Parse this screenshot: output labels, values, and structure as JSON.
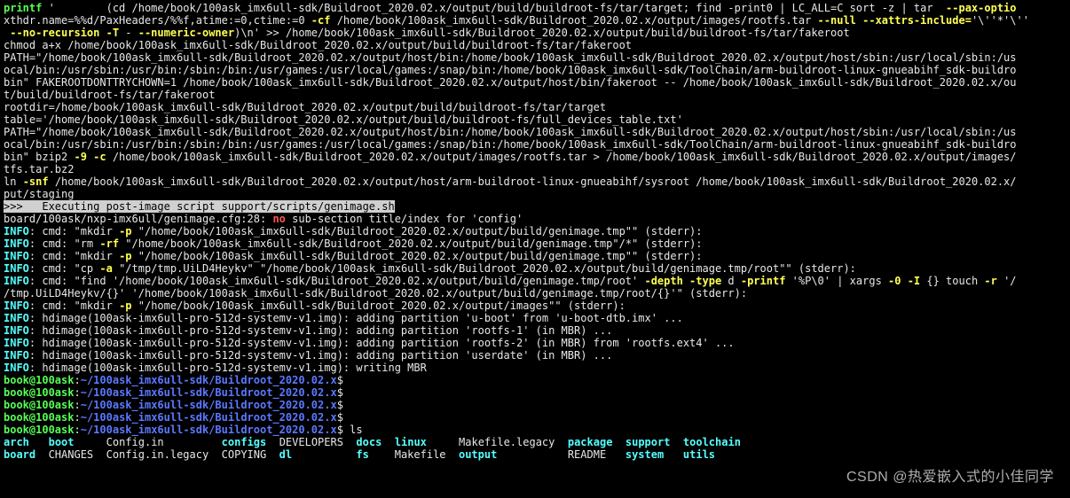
{
  "lines": [
    [
      {
        "c": "green",
        "t": "printf"
      },
      {
        "c": "white",
        "t": " '        (cd /home/book/100ask_imx6ull-sdk/Buildroot_2020.02.x/output/build/buildroot-fs/tar/target; find -print0 | LC_ALL=C sort -z | tar  "
      },
      {
        "c": "yellow",
        "t": "--pax-optio"
      }
    ],
    [
      {
        "c": "white",
        "t": "xthdr.name=%%d/PaxHeaders/%%f,atime:=0,ctime:=0 "
      },
      {
        "c": "yellow",
        "t": "-cf"
      },
      {
        "c": "white",
        "t": " /home/book/100ask_imx6ull-sdk/Buildroot_2020.02.x/output/images/rootfs.tar "
      },
      {
        "c": "yellow",
        "t": "--null --xattrs-include="
      },
      {
        "c": "white",
        "t": "'\\''*'\\''"
      }
    ],
    [
      {
        "c": "yellow",
        "t": " --no-recursion -T"
      },
      {
        "c": "white",
        "t": " - "
      },
      {
        "c": "yellow",
        "t": "--numeric-owner"
      },
      {
        "c": "white",
        "t": ")\\n' >> /home/book/100ask_imx6ull-sdk/Buildroot_2020.02.x/output/build/buildroot-fs/tar/fakeroot"
      }
    ],
    [
      {
        "c": "white",
        "t": "chmod a+x /home/book/100ask_imx6ull-sdk/Buildroot_2020.02.x/output/build/buildroot-fs/tar/fakeroot"
      }
    ],
    [
      {
        "c": "white",
        "t": "PATH=\"/home/book/100ask_imx6ull-sdk/Buildroot_2020.02.x/output/host/bin:/home/book/100ask_imx6ull-sdk/Buildroot_2020.02.x/output/host/sbin:/usr/local/sbin:/us"
      }
    ],
    [
      {
        "c": "white",
        "t": "ocal/bin:/usr/sbin:/usr/bin:/sbin:/bin:/usr/games:/usr/local/games:/snap/bin:/home/book/100ask_imx6ull-sdk/ToolChain/arm-buildroot-linux-gnueabihf_sdk-buildro"
      }
    ],
    [
      {
        "c": "white",
        "t": "bin\" FAKEROOTDONTTRYCHOWN=1 /home/book/100ask_imx6ull-sdk/Buildroot_2020.02.x/output/host/bin/fakeroot -- /home/book/100ask_imx6ull-sdk/Buildroot_2020.02.x/ou"
      }
    ],
    [
      {
        "c": "white",
        "t": "t/build/buildroot-fs/tar/fakeroot"
      }
    ],
    [
      {
        "c": "white",
        "t": "rootdir=/home/book/100ask_imx6ull-sdk/Buildroot_2020.02.x/output/build/buildroot-fs/tar/target"
      }
    ],
    [
      {
        "c": "white",
        "t": "table='/home/book/100ask_imx6ull-sdk/Buildroot_2020.02.x/output/build/buildroot-fs/full_devices_table.txt'"
      }
    ],
    [
      {
        "c": "white",
        "t": "PATH=\"/home/book/100ask_imx6ull-sdk/Buildroot_2020.02.x/output/host/bin:/home/book/100ask_imx6ull-sdk/Buildroot_2020.02.x/output/host/sbin:/usr/local/sbin:/us"
      }
    ],
    [
      {
        "c": "white",
        "t": "ocal/bin:/usr/sbin:/usr/bin:/sbin:/bin:/usr/games:/usr/local/games:/snap/bin:/home/book/100ask_imx6ull-sdk/ToolChain/arm-buildroot-linux-gnueabihf_sdk-buildro"
      }
    ],
    [
      {
        "c": "white",
        "t": "bin\" bzip2 "
      },
      {
        "c": "yellow",
        "t": "-9 -c"
      },
      {
        "c": "white",
        "t": " /home/book/100ask_imx6ull-sdk/Buildroot_2020.02.x/output/images/rootfs.tar > /home/book/100ask_imx6ull-sdk/Buildroot_2020.02.x/output/images/"
      }
    ],
    [
      {
        "c": "white",
        "t": "tfs.tar.bz2"
      }
    ],
    [
      {
        "c": "white",
        "t": "ln "
      },
      {
        "c": "yellow",
        "t": "-snf"
      },
      {
        "c": "white",
        "t": " /home/book/100ask_imx6ull-sdk/Buildroot_2020.02.x/output/host/arm-buildroot-linux-gnueabihf/sysroot /home/book/100ask_imx6ull-sdk/Buildroot_2020.02.x/"
      }
    ],
    [
      {
        "c": "white",
        "t": "put/staging"
      }
    ],
    [
      {
        "c": "inv",
        "t": ">>>   Executing post-image script support/scripts/genimage.sh"
      },
      {
        "c": "white",
        "t": "                                                                                                "
      }
    ],
    [
      {
        "c": "white",
        "t": "board/100ask/nxp-imx6ull/genimage.cfg:28: "
      },
      {
        "c": "red",
        "t": "no"
      },
      {
        "c": "white",
        "t": " sub-section title/index for 'config'"
      }
    ],
    [
      {
        "c": "cyan",
        "t": "INFO"
      },
      {
        "c": "white",
        "t": ": cmd: \"mkdir "
      },
      {
        "c": "yellow",
        "t": "-p"
      },
      {
        "c": "white",
        "t": " \"/home/book/100ask_imx6ull-sdk/Buildroot_2020.02.x/output/build/genimage.tmp\"\" (stderr):"
      }
    ],
    [
      {
        "c": "cyan",
        "t": "INFO"
      },
      {
        "c": "white",
        "t": ": cmd: \"rm "
      },
      {
        "c": "yellow",
        "t": "-rf"
      },
      {
        "c": "white",
        "t": " \"/home/book/100ask_imx6ull-sdk/Buildroot_2020.02.x/output/build/genimage.tmp\"/*\" (stderr):"
      }
    ],
    [
      {
        "c": "cyan",
        "t": "INFO"
      },
      {
        "c": "white",
        "t": ": cmd: \"mkdir "
      },
      {
        "c": "yellow",
        "t": "-p"
      },
      {
        "c": "white",
        "t": " \"/home/book/100ask_imx6ull-sdk/Buildroot_2020.02.x/output/build/genimage.tmp\"\" (stderr):"
      }
    ],
    [
      {
        "c": "cyan",
        "t": "INFO"
      },
      {
        "c": "white",
        "t": ": cmd: \"cp "
      },
      {
        "c": "yellow",
        "t": "-a"
      },
      {
        "c": "white",
        "t": " \"/tmp/tmp.UiLD4Heykv\" \"/home/book/100ask_imx6ull-sdk/Buildroot_2020.02.x/output/build/genimage.tmp/root\"\" (stderr):"
      }
    ],
    [
      {
        "c": "cyan",
        "t": "INFO"
      },
      {
        "c": "white",
        "t": ": cmd: \"find '/home/book/100ask_imx6ull-sdk/Buildroot_2020.02.x/output/build/genimage.tmp/root' "
      },
      {
        "c": "yellow",
        "t": "-depth -type"
      },
      {
        "c": "white",
        "t": " d "
      },
      {
        "c": "yellow",
        "t": "-printf"
      },
      {
        "c": "white",
        "t": " '%P\\0' | xargs "
      },
      {
        "c": "yellow",
        "t": "-0 -I"
      },
      {
        "c": "white",
        "t": " {} touch "
      },
      {
        "c": "yellow",
        "t": "-r"
      },
      {
        "c": "white",
        "t": " '/"
      }
    ],
    [
      {
        "c": "white",
        "t": "/tmp.UiLD4Heykv/{}' '/home/book/100ask_imx6ull-sdk/Buildroot_2020.02.x/output/build/genimage.tmp/root/{}'\" (stderr):"
      }
    ],
    [
      {
        "c": "cyan",
        "t": "INFO"
      },
      {
        "c": "white",
        "t": ": cmd: \"mkdir "
      },
      {
        "c": "yellow",
        "t": "-p"
      },
      {
        "c": "white",
        "t": " \"/home/book/100ask_imx6ull-sdk/Buildroot_2020.02.x/output/images\"\" (stderr):"
      }
    ],
    [
      {
        "c": "cyan",
        "t": "INFO"
      },
      {
        "c": "white",
        "t": ": hdimage(100ask-imx6ull-pro-512d-systemv-v1.img): adding partition 'u-boot' from 'u-boot-dtb.imx' ..."
      }
    ],
    [
      {
        "c": "cyan",
        "t": "INFO"
      },
      {
        "c": "white",
        "t": ": hdimage(100ask-imx6ull-pro-512d-systemv-v1.img): adding partition 'rootfs-1' (in MBR) ..."
      }
    ],
    [
      {
        "c": "cyan",
        "t": "INFO"
      },
      {
        "c": "white",
        "t": ": hdimage(100ask-imx6ull-pro-512d-systemv-v1.img): adding partition 'rootfs-2' (in MBR) from 'rootfs.ext4' ..."
      }
    ],
    [
      {
        "c": "cyan",
        "t": "INFO"
      },
      {
        "c": "white",
        "t": ": hdimage(100ask-imx6ull-pro-512d-systemv-v1.img): adding partition 'userdate' (in MBR) ..."
      }
    ],
    [
      {
        "c": "cyan",
        "t": "INFO"
      },
      {
        "c": "white",
        "t": ": hdimage(100ask-imx6ull-pro-512d-systemv-v1.img): writing MBR"
      }
    ],
    [
      {
        "c": "green",
        "t": "book@100ask"
      },
      {
        "c": "white",
        "t": ":"
      },
      {
        "c": "blue",
        "t": "~/100ask_imx6ull-sdk/Buildroot_2020.02.x"
      },
      {
        "c": "white",
        "t": "$"
      }
    ],
    [
      {
        "c": "green",
        "t": "book@100ask"
      },
      {
        "c": "white",
        "t": ":"
      },
      {
        "c": "blue",
        "t": "~/100ask_imx6ull-sdk/Buildroot_2020.02.x"
      },
      {
        "c": "white",
        "t": "$"
      }
    ],
    [
      {
        "c": "green",
        "t": "book@100ask"
      },
      {
        "c": "white",
        "t": ":"
      },
      {
        "c": "blue",
        "t": "~/100ask_imx6ull-sdk/Buildroot_2020.02.x"
      },
      {
        "c": "white",
        "t": "$"
      }
    ],
    [
      {
        "c": "green",
        "t": "book@100ask"
      },
      {
        "c": "white",
        "t": ":"
      },
      {
        "c": "blue",
        "t": "~/100ask_imx6ull-sdk/Buildroot_2020.02.x"
      },
      {
        "c": "white",
        "t": "$"
      }
    ],
    [
      {
        "c": "green",
        "t": "book@100ask"
      },
      {
        "c": "white",
        "t": ":"
      },
      {
        "c": "blue",
        "t": "~/100ask_imx6ull-sdk/Buildroot_2020.02.x"
      },
      {
        "c": "white",
        "t": "$ ls"
      }
    ],
    [
      {
        "c": "cyan",
        "t": "arch"
      },
      {
        "c": "white",
        "t": "   "
      },
      {
        "c": "cyan",
        "t": "boot"
      },
      {
        "c": "white",
        "t": "     Config.in         "
      },
      {
        "c": "cyan",
        "t": "configs"
      },
      {
        "c": "white",
        "t": "  DEVELOPERS  "
      },
      {
        "c": "cyan",
        "t": "docs"
      },
      {
        "c": "white",
        "t": "  "
      },
      {
        "c": "cyan",
        "t": "linux"
      },
      {
        "c": "white",
        "t": "     Makefile.legacy  "
      },
      {
        "c": "cyan",
        "t": "package"
      },
      {
        "c": "white",
        "t": "  "
      },
      {
        "c": "cyan",
        "t": "support"
      },
      {
        "c": "white",
        "t": "  "
      },
      {
        "c": "cyan",
        "t": "toolchain"
      }
    ],
    [
      {
        "c": "cyan",
        "t": "board"
      },
      {
        "c": "white",
        "t": "  CHANGES  Config.in.legacy  COPYING  "
      },
      {
        "c": "cyan",
        "t": "dl"
      },
      {
        "c": "white",
        "t": "          "
      },
      {
        "c": "cyan",
        "t": "fs"
      },
      {
        "c": "white",
        "t": "    Makefile  "
      },
      {
        "c": "cyan",
        "t": "output"
      },
      {
        "c": "white",
        "t": "           README   "
      },
      {
        "c": "cyan",
        "t": "system"
      },
      {
        "c": "white",
        "t": "   "
      },
      {
        "c": "cyan",
        "t": "utils"
      }
    ]
  ],
  "watermark": "CSDN @热爱嵌入式的小佳同学"
}
